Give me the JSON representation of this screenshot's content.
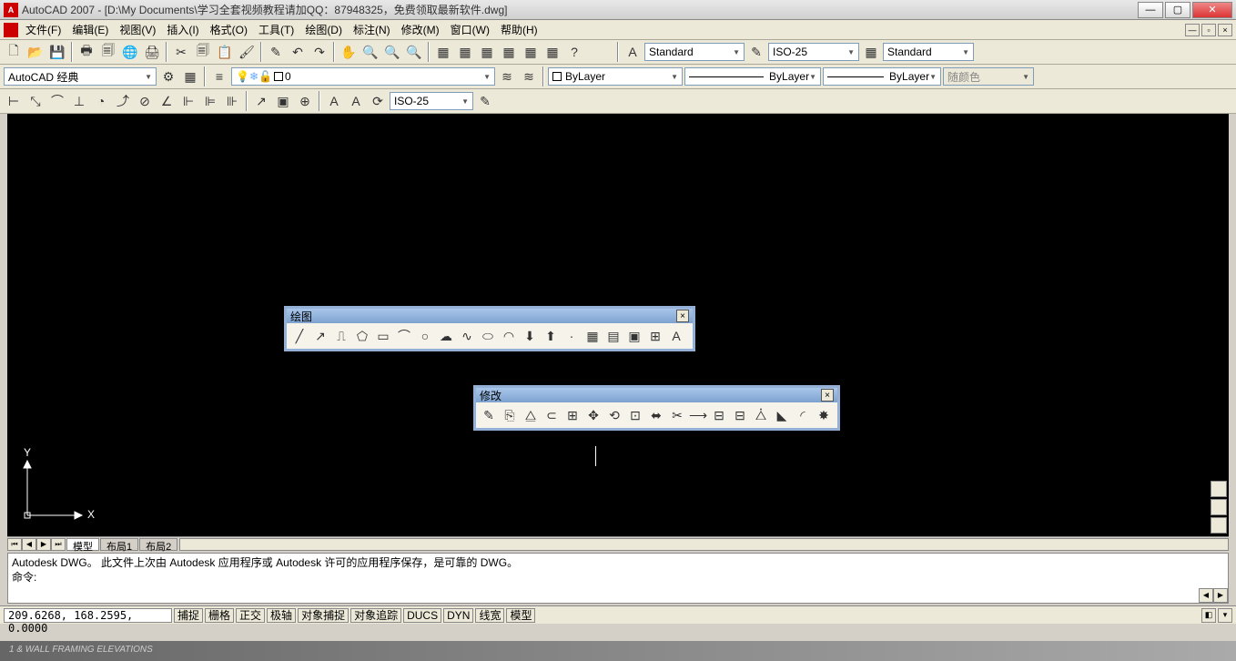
{
  "title": "AutoCAD 2007 - [D:\\My Documents\\学习全套视频教程请加QQ：87948325，免费领取最新软件.dwg]",
  "menu": {
    "items": [
      "文件(F)",
      "编辑(E)",
      "视图(V)",
      "插入(I)",
      "格式(O)",
      "工具(T)",
      "绘图(D)",
      "标注(N)",
      "修改(M)",
      "窗口(W)",
      "帮助(H)"
    ]
  },
  "workspace": {
    "current": "AutoCAD 经典"
  },
  "layer": {
    "current": "0"
  },
  "styles": {
    "text_style": "Standard",
    "dim_style": "ISO-25",
    "table_style": "Standard"
  },
  "properties": {
    "color": "ByLayer",
    "linetype": "ByLayer",
    "lineweight": "ByLayer",
    "plotstyle": "随颜色"
  },
  "dim_toolbar": {
    "current": "ISO-25"
  },
  "float_toolbars": {
    "draw": {
      "title": "绘图"
    },
    "modify": {
      "title": "修改"
    }
  },
  "ucs": {
    "x_label": "X",
    "y_label": "Y"
  },
  "layout_tabs": {
    "tabs": [
      "模型",
      "布局1",
      "布局2"
    ]
  },
  "command": {
    "line1": "Autodesk DWG。 此文件上次由 Autodesk 应用程序或 Autodesk 许可的应用程序保存，是可靠的 DWG。",
    "prompt": "命令:"
  },
  "status": {
    "coords": "209.6268, 168.2595, 0.0000",
    "toggles": [
      "捕捉",
      "栅格",
      "正交",
      "极轴",
      "对象捕捉",
      "对象追踪",
      "DUCS",
      "DYN",
      "线宽",
      "模型"
    ]
  },
  "footer": "1 & WALL FRAMING ELEVATIONS"
}
